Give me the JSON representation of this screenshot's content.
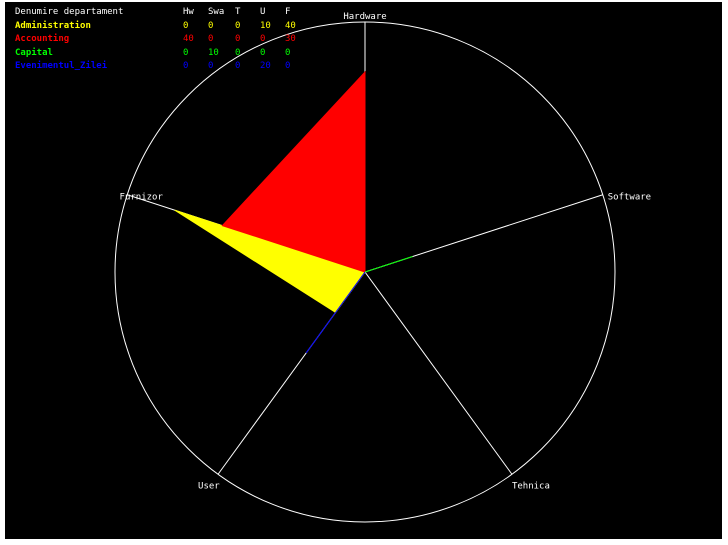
{
  "chart_data": {
    "type": "radar",
    "axes": [
      "Hardware",
      "Software",
      "Tehnica",
      "User",
      "Furnizor"
    ],
    "rmax": 50,
    "grid": false,
    "legend_position": "top-left",
    "legend": {
      "header": {
        "name": "Denumire departament",
        "columns": [
          "Hw",
          "Swa",
          "T",
          "U",
          "F"
        ]
      }
    },
    "series": [
      {
        "name": "Administration",
        "color": "#ffff00",
        "values": [
          0,
          0,
          0,
          10,
          40
        ]
      },
      {
        "name": "Accounting",
        "color": "#ff0000",
        "values": [
          40,
          0,
          0,
          0,
          30
        ]
      },
      {
        "name": "Capital",
        "color": "#00ff00",
        "values": [
          0,
          10,
          0,
          0,
          0
        ]
      },
      {
        "name": "Evenimentul_Zilei",
        "color": "#0000ff",
        "values": [
          0,
          0,
          0,
          20,
          0
        ]
      }
    ]
  }
}
